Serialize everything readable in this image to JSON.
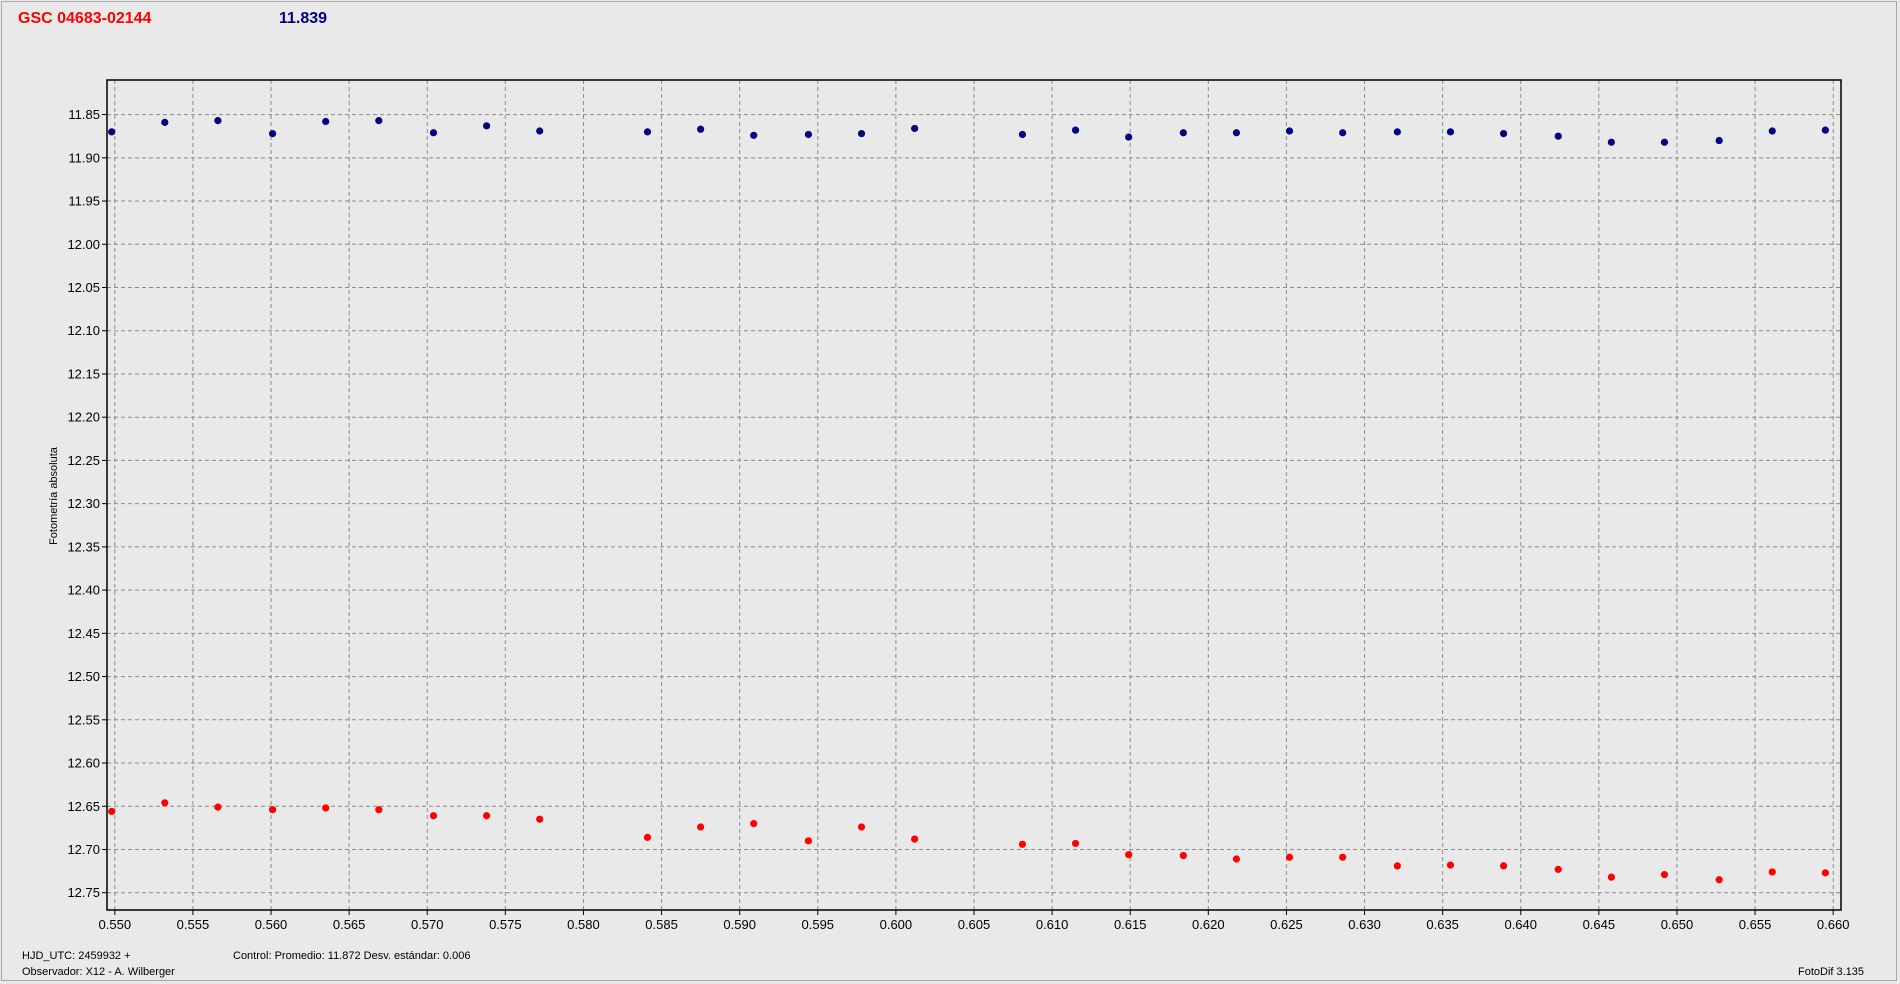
{
  "header": {
    "star_name": "GSC 04683-02144",
    "star_magnitude": "11.839"
  },
  "footer": {
    "hjd": "HJD_UTC: 2459932 +",
    "observer": "Observador: X12 - A. Wilberger",
    "control": "Control: Promedio: 11.872   Desv. estándar: 0.006",
    "version": "FotoDif 3.135"
  },
  "colors": {
    "title": "#ff0000",
    "magnitude": "#000080",
    "control_series": "#000080",
    "target_series": "#ff0000",
    "background": "#e9e9e9"
  },
  "chart_data": {
    "type": "scatter",
    "title": "",
    "xlabel": "",
    "ylabel": "Fotometría absoluta",
    "xlim": [
      0.5495,
      0.6605
    ],
    "ylim": [
      11.81,
      12.77
    ],
    "y_inverted": true,
    "grid": true,
    "x_ticks": [
      "0.550",
      "0.555",
      "0.560",
      "0.565",
      "0.570",
      "0.575",
      "0.580",
      "0.585",
      "0.590",
      "0.595",
      "0.600",
      "0.605",
      "0.610",
      "0.615",
      "0.620",
      "0.625",
      "0.630",
      "0.635",
      "0.640",
      "0.645",
      "0.650",
      "0.655",
      "0.660"
    ],
    "y_ticks": [
      "11.85",
      "11.90",
      "11.95",
      "12.00",
      "12.05",
      "12.10",
      "12.15",
      "12.20",
      "12.25",
      "12.30",
      "12.35",
      "12.40",
      "12.45",
      "12.50",
      "12.55",
      "12.60",
      "12.65",
      "12.70",
      "12.75"
    ],
    "series": [
      {
        "color": "#000080",
        "points": [
          [
            0.5498,
            11.87
          ],
          [
            0.5532,
            11.859
          ],
          [
            0.5566,
            11.857
          ],
          [
            0.5601,
            11.872
          ],
          [
            0.5635,
            11.858
          ],
          [
            0.5669,
            11.857
          ],
          [
            0.5704,
            11.871
          ],
          [
            0.5738,
            11.863
          ],
          [
            0.5772,
            11.869
          ],
          [
            0.5841,
            11.87
          ],
          [
            0.5875,
            11.867
          ],
          [
            0.5909,
            11.874
          ],
          [
            0.5944,
            11.873
          ],
          [
            0.5978,
            11.872
          ],
          [
            0.6012,
            11.866
          ],
          [
            0.6081,
            11.873
          ],
          [
            0.6115,
            11.868
          ],
          [
            0.6149,
            11.876
          ],
          [
            0.6184,
            11.871
          ],
          [
            0.6218,
            11.871
          ],
          [
            0.6252,
            11.869
          ],
          [
            0.6286,
            11.871
          ],
          [
            0.6321,
            11.87
          ],
          [
            0.6355,
            11.87
          ],
          [
            0.6389,
            11.872
          ],
          [
            0.6424,
            11.875
          ],
          [
            0.6458,
            11.882
          ],
          [
            0.6492,
            11.882
          ],
          [
            0.6527,
            11.88
          ],
          [
            0.6561,
            11.869
          ],
          [
            0.6595,
            11.868
          ]
        ]
      },
      {
        "color": "#ff0000",
        "points": [
          [
            0.5498,
            12.656
          ],
          [
            0.5532,
            12.646
          ],
          [
            0.5566,
            12.651
          ],
          [
            0.5601,
            12.654
          ],
          [
            0.5635,
            12.652
          ],
          [
            0.5669,
            12.654
          ],
          [
            0.5704,
            12.661
          ],
          [
            0.5738,
            12.661
          ],
          [
            0.5772,
            12.665
          ],
          [
            0.5841,
            12.686
          ],
          [
            0.5875,
            12.674
          ],
          [
            0.5909,
            12.67
          ],
          [
            0.5944,
            12.69
          ],
          [
            0.5978,
            12.674
          ],
          [
            0.6012,
            12.688
          ],
          [
            0.6081,
            12.694
          ],
          [
            0.6115,
            12.693
          ],
          [
            0.6149,
            12.706
          ],
          [
            0.6184,
            12.707
          ],
          [
            0.6218,
            12.711
          ],
          [
            0.6252,
            12.709
          ],
          [
            0.6286,
            12.709
          ],
          [
            0.6321,
            12.719
          ],
          [
            0.6355,
            12.718
          ],
          [
            0.6389,
            12.719
          ],
          [
            0.6424,
            12.723
          ],
          [
            0.6458,
            12.732
          ],
          [
            0.6492,
            12.729
          ],
          [
            0.6527,
            12.735
          ],
          [
            0.6561,
            12.726
          ],
          [
            0.6595,
            12.727
          ]
        ]
      }
    ]
  }
}
